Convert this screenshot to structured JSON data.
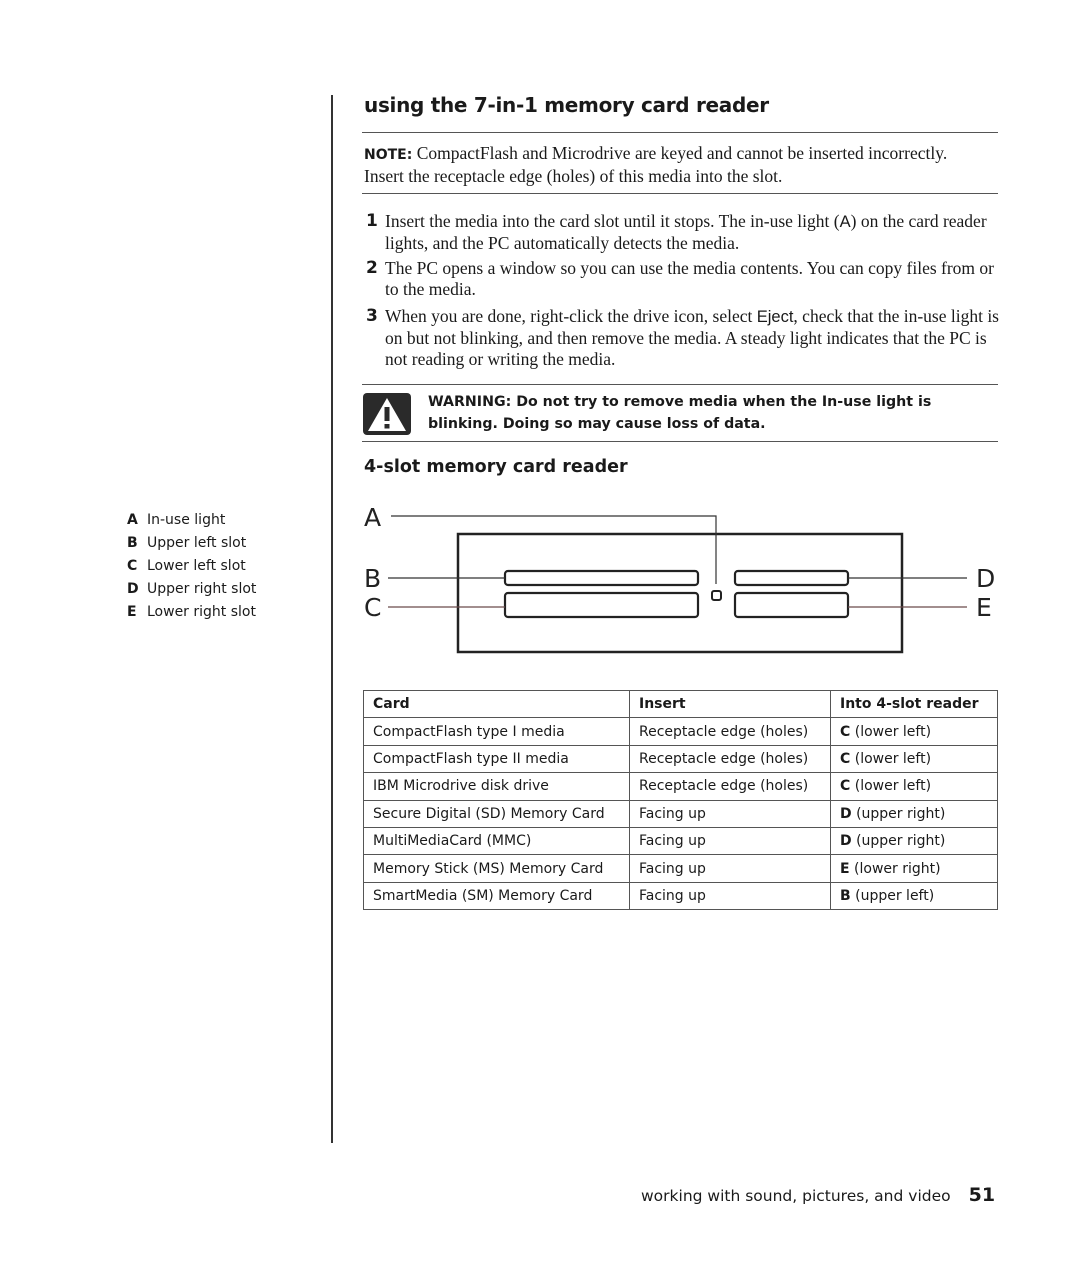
{
  "section": {
    "title": "using the 7-in-1 memory card reader",
    "note": {
      "label": "NOTE:",
      "text": " CompactFlash and Microdrive are keyed and cannot be inserted incorrectly. Insert the receptacle edge (holes) of this media into the slot."
    },
    "steps": [
      {
        "num": "1",
        "before": "Insert the media into the card slot until it stops. The in-use light (",
        "ui": "A",
        "after": ") on the card reader lights, and the PC automatically detects the media."
      },
      {
        "num": "2",
        "before": "The PC opens a window so you can use the media contents. You can copy files from or to the media.",
        "ui": "",
        "after": ""
      },
      {
        "num": "3",
        "before": "When you are done, right-click the drive icon, select ",
        "ui": "Eject",
        "after": ", check that the in-use light is on but not blinking, and then remove the media. A steady light indicates that the PC is not reading or writing the media."
      }
    ],
    "warning": {
      "icon": "warning-triangle-icon",
      "text": "WARNING: Do not try to remove media when the In-use light is blinking. Doing so may cause loss of data."
    }
  },
  "subsection": {
    "title": "4-slot memory card reader"
  },
  "legend": [
    {
      "key": "A",
      "label": "In-use light"
    },
    {
      "key": "B",
      "label": "Upper left slot"
    },
    {
      "key": "C",
      "label": "Lower left slot"
    },
    {
      "key": "D",
      "label": "Upper right slot"
    },
    {
      "key": "E",
      "label": "Lower right slot"
    }
  ],
  "diagram": {
    "callouts": {
      "A": "A",
      "B": "B",
      "C": "C",
      "D": "D",
      "E": "E"
    }
  },
  "table": {
    "headers": [
      "Card",
      "Insert",
      "Into 4-slot reader"
    ],
    "rows": [
      {
        "card": "CompactFlash type I media",
        "insert": "Receptacle edge (holes)",
        "slot": "C",
        "slot_desc": " (lower left)"
      },
      {
        "card": "CompactFlash type II media",
        "insert": "Receptacle edge (holes)",
        "slot": "C",
        "slot_desc": " (lower left)"
      },
      {
        "card": "IBM Microdrive disk drive",
        "insert": "Receptacle edge (holes)",
        "slot": "C",
        "slot_desc": " (lower left)"
      },
      {
        "card": "Secure Digital (SD) Memory Card",
        "insert": "Facing up",
        "slot": "D",
        "slot_desc": " (upper right)"
      },
      {
        "card": "MultiMediaCard (MMC)",
        "insert": "Facing up",
        "slot": "D",
        "slot_desc": " (upper right)"
      },
      {
        "card": "Memory Stick (MS) Memory Card",
        "insert": "Facing up",
        "slot": "E",
        "slot_desc": " (lower right)"
      },
      {
        "card": "SmartMedia (SM) Memory Card",
        "insert": "Facing up",
        "slot": "B",
        "slot_desc": " (upper left)"
      }
    ]
  },
  "footer": {
    "chapter": "working with sound, pictures, and video",
    "page_number": "51"
  }
}
